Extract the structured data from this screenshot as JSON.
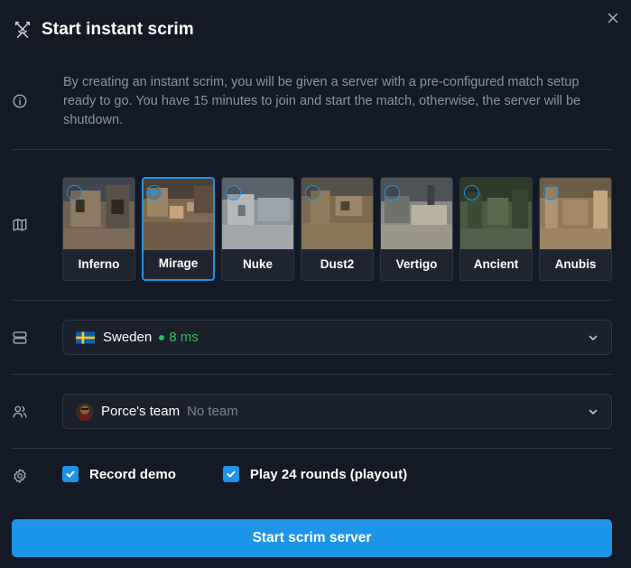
{
  "dialog": {
    "title": "Start instant scrim",
    "info": "By creating an instant scrim, you will be given a server with a pre-configured match setup ready to go. You have 15 minutes to join and start the match, otherwise, the server will be shutdown."
  },
  "maps": [
    {
      "name": "Inferno",
      "selected": false
    },
    {
      "name": "Mirage",
      "selected": true
    },
    {
      "name": "Nuke",
      "selected": false
    },
    {
      "name": "Dust2",
      "selected": false
    },
    {
      "name": "Vertigo",
      "selected": false
    },
    {
      "name": "Ancient",
      "selected": false
    },
    {
      "name": "Anubis",
      "selected": false
    }
  ],
  "server": {
    "region": "Sweden",
    "ping": "8 ms"
  },
  "team": {
    "name": "Porce's team",
    "sub": "No team"
  },
  "options": {
    "record_demo": "Record demo",
    "playout": "Play 24 rounds (playout)"
  },
  "actions": {
    "start": "Start scrim server"
  },
  "colors": {
    "accent": "#1c95e9",
    "background": "#141a25",
    "ping": "#2fbf62",
    "muted": "#8b93a3"
  }
}
